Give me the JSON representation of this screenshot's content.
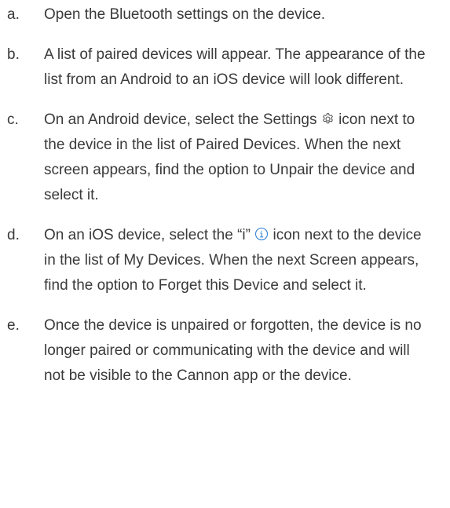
{
  "steps": [
    {
      "marker": "a.",
      "text": "Open the Bluetooth settings on the device."
    },
    {
      "marker": "b.",
      "text": "A list of paired devices will appear. The appearance of the list from an Android to an iOS device will look different."
    },
    {
      "marker": "c.",
      "text_before_icon": "On an Android device, select the Settings",
      "icon": "settings-gear-icon",
      "text_after_icon": "icon next to the device in the list of Paired Devices. When the next screen appears, find the option to Unpair the device and select it."
    },
    {
      "marker": "d.",
      "text_before_icon": "On an iOS device, select the “i”",
      "icon": "info-circle-icon",
      "icon_color": "#3b86d8",
      "text_after_icon": "icon next to the device in the list of My Devices. When the next Screen appears, find the option to Forget this Device and select it."
    },
    {
      "marker": "e.",
      "text": "Once the device is unpaired or forgotten, the device is no longer paired or communicating with the device and will not be visible to the Cannon app or the device."
    }
  ]
}
